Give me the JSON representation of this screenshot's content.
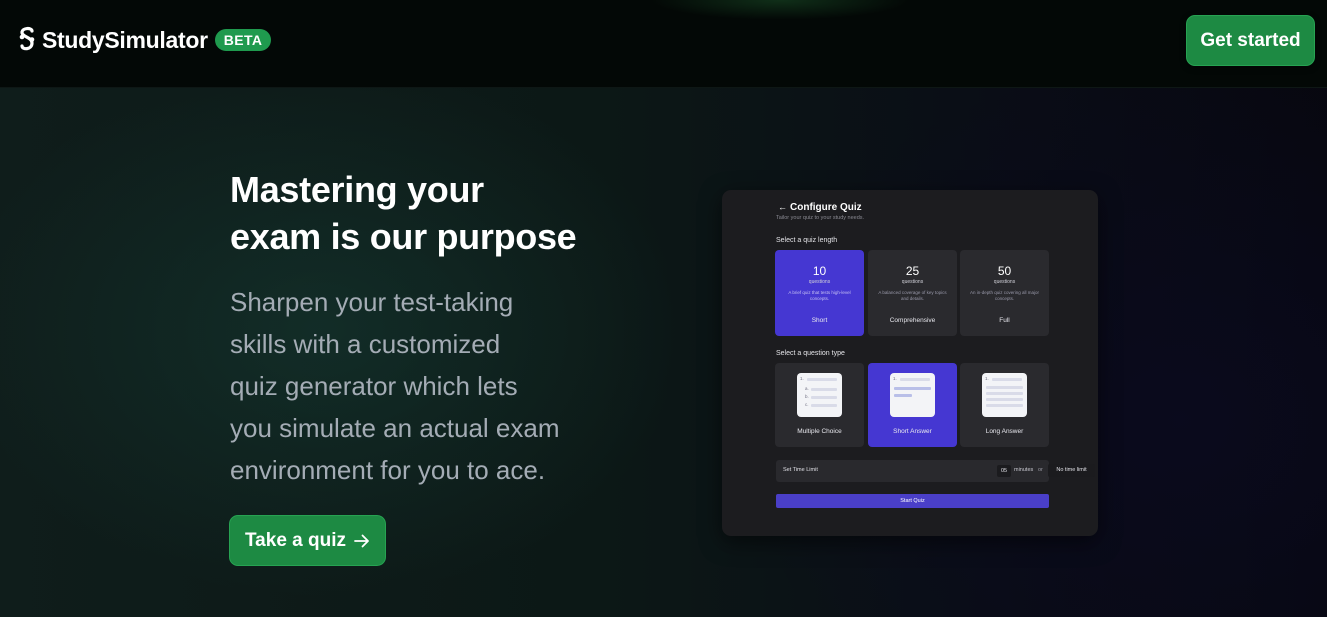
{
  "nav": {
    "brand_name": "StudySimulator",
    "beta_badge": "BETA",
    "cta_label": "Get started"
  },
  "hero": {
    "title_line1": "Mastering your",
    "title_line2": "exam is our purpose",
    "subtitle_lines": [
      "Sharpen your test-taking",
      "skills with a customized",
      "quiz generator which lets",
      "you simulate an actual exam",
      "environment for you to ace."
    ],
    "cta_label": "Take a quiz",
    "cta_icon": "arrow-right-icon"
  },
  "preview": {
    "back_icon": "←",
    "title": "Configure Quiz",
    "subtitle": "Tailor your quiz to your study needs.",
    "length_label": "Select a quiz length",
    "lengths": [
      {
        "count": "10",
        "unit": "questions",
        "desc": "A brief quiz that tests high-level concepts.",
        "name": "Short",
        "selected": true
      },
      {
        "count": "25",
        "unit": "questions",
        "desc": "A balanced coverage of key topics and details.",
        "name": "Comprehensive",
        "selected": false
      },
      {
        "count": "50",
        "unit": "questions",
        "desc": "An in-depth quiz covering all major concepts.",
        "name": "Full",
        "selected": false
      }
    ],
    "type_label": "Select a question type",
    "types": [
      {
        "name": "Multiple Choice",
        "selected": false
      },
      {
        "name": "Short Answer",
        "selected": true
      },
      {
        "name": "Long Answer",
        "selected": false
      }
    ],
    "time_label": "Set Time Limit",
    "time_value": "05",
    "time_unit": "minutes",
    "time_or": "or",
    "no_limit_label": "No time limit",
    "start_label": "Start Quiz"
  },
  "colors": {
    "accent_green": "#1d8a43",
    "accent_purple": "#4537d2",
    "badge_green": "#1f9a4e"
  }
}
